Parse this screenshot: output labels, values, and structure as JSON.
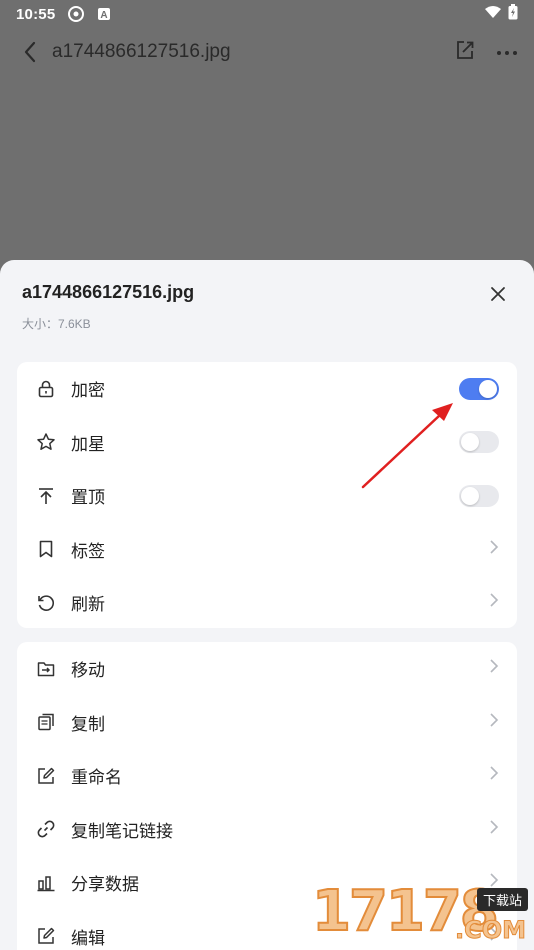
{
  "status_bar": {
    "time": "10:55"
  },
  "topbar": {
    "title": "a1744866127516.jpg"
  },
  "sheet": {
    "file_name": "a1744866127516.jpg",
    "file_size": "大小：7.6KB",
    "group1": [
      {
        "label": "加密",
        "icon": "lock-icon",
        "type": "toggle",
        "on": true
      },
      {
        "label": "加星",
        "icon": "star-icon",
        "type": "toggle",
        "on": false
      },
      {
        "label": "置顶",
        "icon": "pin-top-icon",
        "type": "toggle",
        "on": false
      },
      {
        "label": "标签",
        "icon": "bookmark-icon",
        "type": "chevron"
      },
      {
        "label": "刷新",
        "icon": "refresh-icon",
        "type": "chevron"
      }
    ],
    "group2": [
      {
        "label": "移动",
        "icon": "move-icon",
        "type": "chevron"
      },
      {
        "label": "复制",
        "icon": "copy-icon",
        "type": "chevron"
      },
      {
        "label": "重命名",
        "icon": "rename-icon",
        "type": "chevron"
      },
      {
        "label": "复制笔记链接",
        "icon": "link-icon",
        "type": "chevron"
      },
      {
        "label": "分享数据",
        "icon": "bar-chart-icon",
        "type": "chevron"
      },
      {
        "label": "编辑",
        "icon": "edit-icon",
        "type": "chevron"
      }
    ]
  },
  "watermark": {
    "digits": "17178",
    "tag": "下载站",
    "com": ".COM"
  },
  "colors": {
    "accent": "#4e7df1",
    "annotation_arrow": "#e02020",
    "overlay": "#6f6f6f",
    "sheet_bg": "#f3f4f7"
  }
}
